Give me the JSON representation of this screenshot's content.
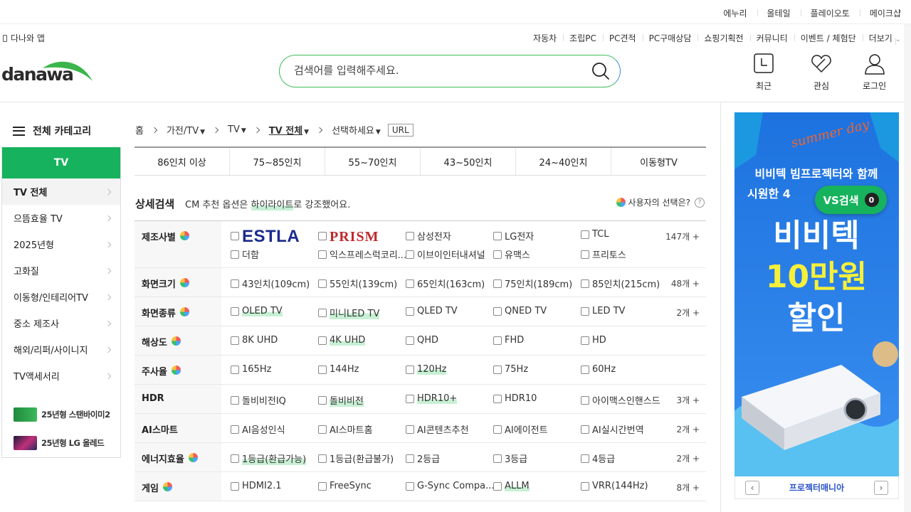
{
  "util_links": [
    "에누리",
    "올테일",
    "플레이오토",
    "메이크샵"
  ],
  "app_link": "다나와 앱",
  "gnb": [
    "자동차",
    "조립PC",
    "PC견적",
    "PC구매상담",
    "쇼핑기획전",
    "커뮤니티",
    "이벤트 / 체험단",
    "더보기"
  ],
  "logo_text": "danawa",
  "search": {
    "placeholder": "검색어를 입력해주세요."
  },
  "quick": {
    "recent": "최근",
    "interest": "관심",
    "login": "로그인"
  },
  "category": {
    "title": "전체 카테고리",
    "head": "TV",
    "items": [
      "TV 전체",
      "으뜸효율 TV",
      "2025년형",
      "고화질",
      "이동형/인테리어TV",
      "중소 제조사",
      "해외/리퍼/사이니지",
      "TV액세서리"
    ],
    "promos": [
      "25년형 스탠바이미2",
      "25년형 LG 올레드"
    ]
  },
  "breadcrumb": {
    "home": "홈",
    "l1": "가전/TV",
    "l2": "TV",
    "l3": "TV 전체",
    "l4": "선택하세요",
    "url": "URL"
  },
  "size_tabs": [
    "86인치 이상",
    "75~85인치",
    "55~70인치",
    "43~50인치",
    "24~40인치",
    "이동형TV"
  ],
  "detail": {
    "title": "상세검색",
    "desc_pre": "CM 추천 옵션은 ",
    "desc_hl": "하이라이트",
    "desc_post": "로 강조했어요.",
    "user_choice": "사용자의 선택은?"
  },
  "filters": [
    {
      "name": "제조사별",
      "count": "147개 +",
      "r1": [
        "ESTLA",
        "PRISM",
        "삼성전자",
        "LG전자",
        "TCL"
      ],
      "r2": [
        "더함",
        "익스프레스럭코리...",
        "이브이인터내셔널",
        "유맥스",
        "프리토스"
      ]
    },
    {
      "name": "화면크기",
      "count": "48개 +",
      "opts": [
        "43인치(109cm)",
        "55인치(139cm)",
        "65인치(163cm)",
        "75인치(189cm)",
        "85인치(215cm)"
      ]
    },
    {
      "name": "화면종류",
      "count": "2개 +",
      "opts": [
        "OLED TV",
        "미니LED TV",
        "QLED TV",
        "QNED TV",
        "LED TV"
      ]
    },
    {
      "name": "해상도",
      "count": "",
      "opts": [
        "8K UHD",
        "4K UHD",
        "QHD",
        "FHD",
        "HD"
      ]
    },
    {
      "name": "주사율",
      "count": "",
      "opts": [
        "165Hz",
        "144Hz",
        "120Hz",
        "75Hz",
        "60Hz"
      ]
    },
    {
      "name": "HDR",
      "count": "3개 +",
      "opts": [
        "돌비비전IQ",
        "돌비비전",
        "HDR10+",
        "HDR10",
        "아이맥스인핸스드"
      ]
    },
    {
      "name": "AI스마트",
      "count": "2개 +",
      "opts": [
        "AI음성인식",
        "AI스마트홈",
        "AI콘텐츠추천",
        "AI에이전트",
        "AI실시간번역"
      ]
    },
    {
      "name": "에너지효율",
      "count": "2개 +",
      "opts": [
        "1등급(환급가능)",
        "1등급(환급불가)",
        "2등급",
        "3등급",
        "4등급"
      ]
    },
    {
      "name": "게임",
      "count": "8개 +",
      "opts": [
        "HDMI2.1",
        "FreeSync",
        "G-Sync Compa...",
        "ALLM",
        "VRR(144Hz)"
      ]
    }
  ],
  "banner": {
    "script": "summer day",
    "line1": "비비텍 빔프로젝터와 함께",
    "line2": "시원한 4",
    "big1": "비비텍",
    "big2": "10만원",
    "big3": "할인",
    "foot": "프로젝터매니아"
  },
  "vs": {
    "label": "VS검색",
    "count": "0"
  },
  "colors": {
    "brand_green": "#17b25d",
    "banner_blue": "#2a7de1",
    "highlight": "#c8f0d4"
  }
}
